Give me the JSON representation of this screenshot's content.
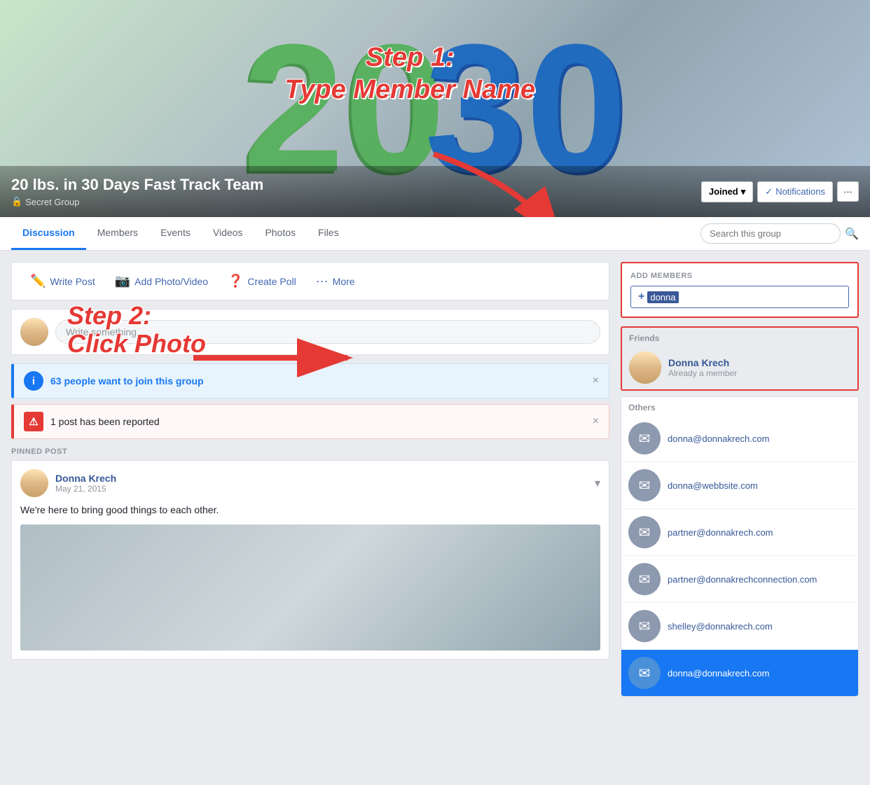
{
  "cover": {
    "group_name": "20 lbs. in 30 Days Fast Track Team",
    "group_type": "Secret Group",
    "num_left": "20",
    "num_right": "30",
    "step1_line1": "Step 1:",
    "step1_line2": "Type Member Name",
    "step2_line1": "Step 2:",
    "step2_line2": "Click Photo"
  },
  "actions": {
    "joined_label": "Joined",
    "notifications_label": "Notifications",
    "more_dots": "···"
  },
  "tabs": {
    "items": [
      {
        "label": "Discussion",
        "active": true
      },
      {
        "label": "Members",
        "active": false
      },
      {
        "label": "Events",
        "active": false
      },
      {
        "label": "Videos",
        "active": false
      },
      {
        "label": "Photos",
        "active": false
      },
      {
        "label": "Files",
        "active": false
      }
    ],
    "search_placeholder": "Search this group"
  },
  "action_bar": {
    "write_post": "Write Post",
    "add_photo": "Add Photo/Video",
    "create_poll": "Create Poll",
    "more": "More"
  },
  "write_post": {
    "placeholder": "Write something..."
  },
  "banners": {
    "blue_text": "63 people want to join this group",
    "red_text": "1 post has been reported"
  },
  "pinned_post": {
    "label": "PINNED POST",
    "author": "Donna Krech",
    "date": "May 21, 2015",
    "text": "We're here to bring good things to each other."
  },
  "add_members": {
    "title": "ADD MEMBERS",
    "input_value": "donna",
    "plus_sign": "+",
    "friends_label": "Friends",
    "member_name": "Donna Krech",
    "member_sub": "Already a member",
    "others_label": "Others",
    "emails": [
      "donna@donnakrech.com",
      "donna@webbsite.com",
      "partner@donnakrech.com",
      "partner@donnakrechconnection.com",
      "shelley@donnakrech.com",
      "donna@donnakrech.com"
    ]
  }
}
